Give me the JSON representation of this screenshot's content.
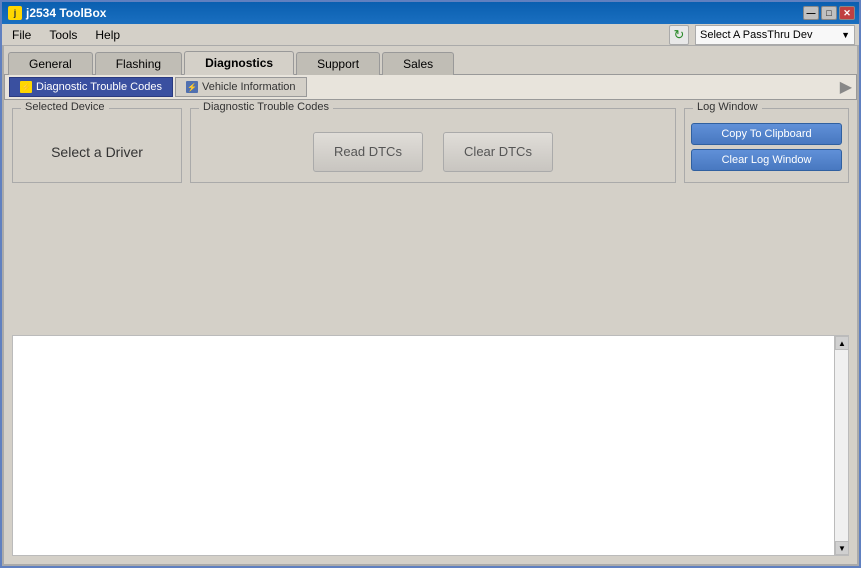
{
  "titleBar": {
    "title": "j2534 ToolBox",
    "iconLabel": "j",
    "minBtn": "—",
    "maxBtn": "□",
    "closeBtn": "✕"
  },
  "menuBar": {
    "items": [
      "File",
      "Tools",
      "Help"
    ]
  },
  "toolbar": {
    "refreshIcon": "↻",
    "passthruPlaceholder": "Select A PassThru Dev",
    "dropdownArrow": "▼"
  },
  "tabs": {
    "items": [
      "General",
      "Flashing",
      "Diagnostics",
      "Support",
      "Sales"
    ],
    "activeIndex": 2
  },
  "subtabs": {
    "items": [
      {
        "label": "Diagnostic Trouble Codes",
        "active": true
      },
      {
        "label": "Vehicle Information",
        "active": false
      }
    ]
  },
  "panels": {
    "selectedDevice": {
      "legend": "Selected Device",
      "content": "Select a Driver"
    },
    "dtc": {
      "legend": "Diagnostic Trouble Codes",
      "readBtn": "Read DTCs",
      "clearBtn": "Clear DTCs"
    },
    "logWindow": {
      "legend": "Log Window",
      "copyBtn": "Copy To Clipboard",
      "clearBtn": "Clear Log Window"
    }
  }
}
